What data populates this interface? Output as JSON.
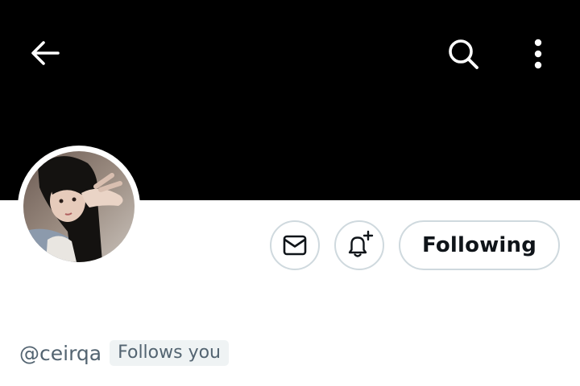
{
  "header": {
    "back_icon": "arrow-left-icon",
    "search_icon": "search-icon",
    "more_icon": "more-vertical-icon",
    "banner_color": "#000000"
  },
  "profile": {
    "avatar": "profile-photo",
    "handle": "@ceirqa",
    "follows_you_label": "Follows you"
  },
  "actions": {
    "message_icon": "envelope-icon",
    "notify_icon": "bell-plus-icon",
    "following_label": "Following"
  },
  "colors": {
    "text_primary": "#0f1419",
    "text_secondary": "#536471",
    "border": "#cfd9de",
    "badge_bg": "#eff3f4"
  }
}
